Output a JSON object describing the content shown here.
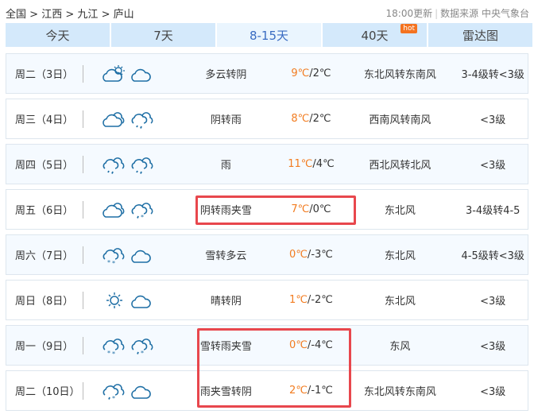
{
  "breadcrumb": [
    "全国",
    "江西",
    "九江",
    "庐山"
  ],
  "crumb_sep": ">",
  "update": "18:00更新",
  "source": "数据来源 中央气象台",
  "tabs": [
    {
      "label": "今天"
    },
    {
      "label": "7天"
    },
    {
      "label": "8-15天",
      "active": true
    },
    {
      "label": "40天",
      "badge": "hot"
    },
    {
      "label": "雷达图"
    }
  ],
  "colors": {
    "accent": "#3a6cc2",
    "high_temp": "#f27c20",
    "highlight_box": "#e8474d",
    "tab_bg": "#d4e9fb",
    "icon": "#1f6fa5"
  },
  "days": [
    {
      "date": "周二（3日）",
      "icons": [
        "cloud-sun-icon",
        "cloud-moon-icon"
      ],
      "weather": "多云转阴",
      "high": "9℃",
      "low": "2℃",
      "wind": "东北风转东南风",
      "level": "3-4级转<3级"
    },
    {
      "date": "周三（4日）",
      "icons": [
        "cloud-icon",
        "cloud-rain-icon"
      ],
      "weather": "阴转雨",
      "high": "8℃",
      "low": "2℃",
      "wind": "西南风转南风",
      "level": "<3级"
    },
    {
      "date": "周四（5日）",
      "icons": [
        "cloud-rain-icon",
        "cloud-rain-icon"
      ],
      "weather": "雨",
      "high": "11℃",
      "low": "4℃",
      "wind": "西北风转北风",
      "level": "<3级"
    },
    {
      "date": "周五（6日）",
      "icons": [
        "cloud-icon",
        "cloud-sleet-icon"
      ],
      "weather": "阴转雨夹雪",
      "high": "7℃",
      "low": "0℃",
      "wind": "东北风",
      "level": "3-4级转4-5"
    },
    {
      "date": "周六（7日）",
      "icons": [
        "cloud-snow-icon",
        "cloud-moon-icon"
      ],
      "weather": "雪转多云",
      "high": "0℃",
      "low": "-3℃",
      "wind": "东北风",
      "level": "4-5级转<3级"
    },
    {
      "date": "周日（8日）",
      "icons": [
        "sun-icon",
        "cloud-moon-icon"
      ],
      "weather": "晴转阴",
      "high": "1℃",
      "low": "-2℃",
      "wind": "东北风",
      "level": "<3级"
    },
    {
      "date": "周一（9日）",
      "icons": [
        "cloud-snow-icon",
        "cloud-sleet-icon"
      ],
      "weather": "雪转雨夹雪",
      "high": "0℃",
      "low": "-4℃",
      "wind": "东风",
      "level": "<3级"
    },
    {
      "date": "周二（10日）",
      "icons": [
        "cloud-sleet-icon",
        "cloud-moon-icon"
      ],
      "weather": "雨夹雪转阴",
      "high": "2℃",
      "low": "-1℃",
      "wind": "东北风转东南风",
      "level": "<3级"
    }
  ]
}
